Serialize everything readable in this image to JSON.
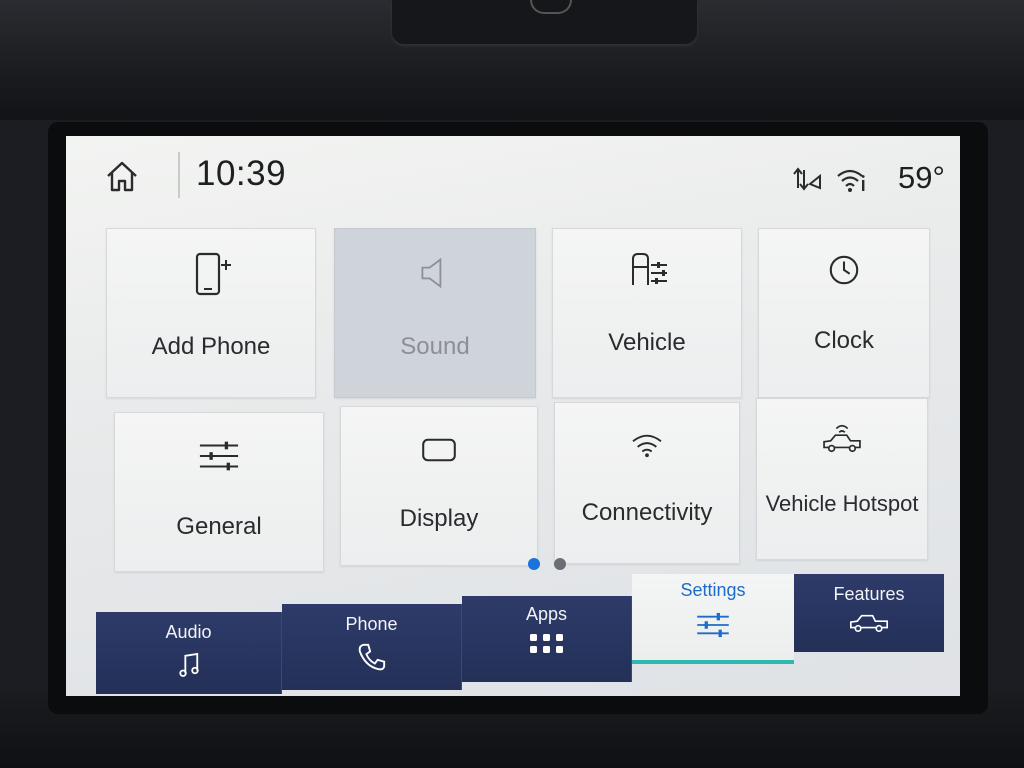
{
  "status": {
    "time": "10:39",
    "temperature": "59°"
  },
  "tiles": [
    {
      "label": "Add Phone",
      "icon": "add-phone-icon",
      "enabled": true
    },
    {
      "label": "Sound",
      "icon": "speaker-icon",
      "enabled": false
    },
    {
      "label": "Vehicle",
      "icon": "vehicle-settings-icon",
      "enabled": true
    },
    {
      "label": "Clock",
      "icon": "clock-icon",
      "enabled": true
    },
    {
      "label": "General",
      "icon": "sliders-icon",
      "enabled": true
    },
    {
      "label": "Display",
      "icon": "display-icon",
      "enabled": true
    },
    {
      "label": "Connectivity",
      "icon": "wifi-icon",
      "enabled": true
    },
    {
      "label": "Vehicle Hotspot",
      "icon": "vehicle-hotspot-icon",
      "enabled": true
    }
  ],
  "pagination": {
    "current": 1,
    "total": 2,
    "active_color": "#1a73d9",
    "inactive_color": "#6b6f75"
  },
  "nav": {
    "audio": "Audio",
    "phone": "Phone",
    "apps": "Apps",
    "settings": "Settings",
    "features": "Features",
    "active": "settings",
    "active_color": "#1d6cc9",
    "underline_color": "#2fb9b0"
  }
}
